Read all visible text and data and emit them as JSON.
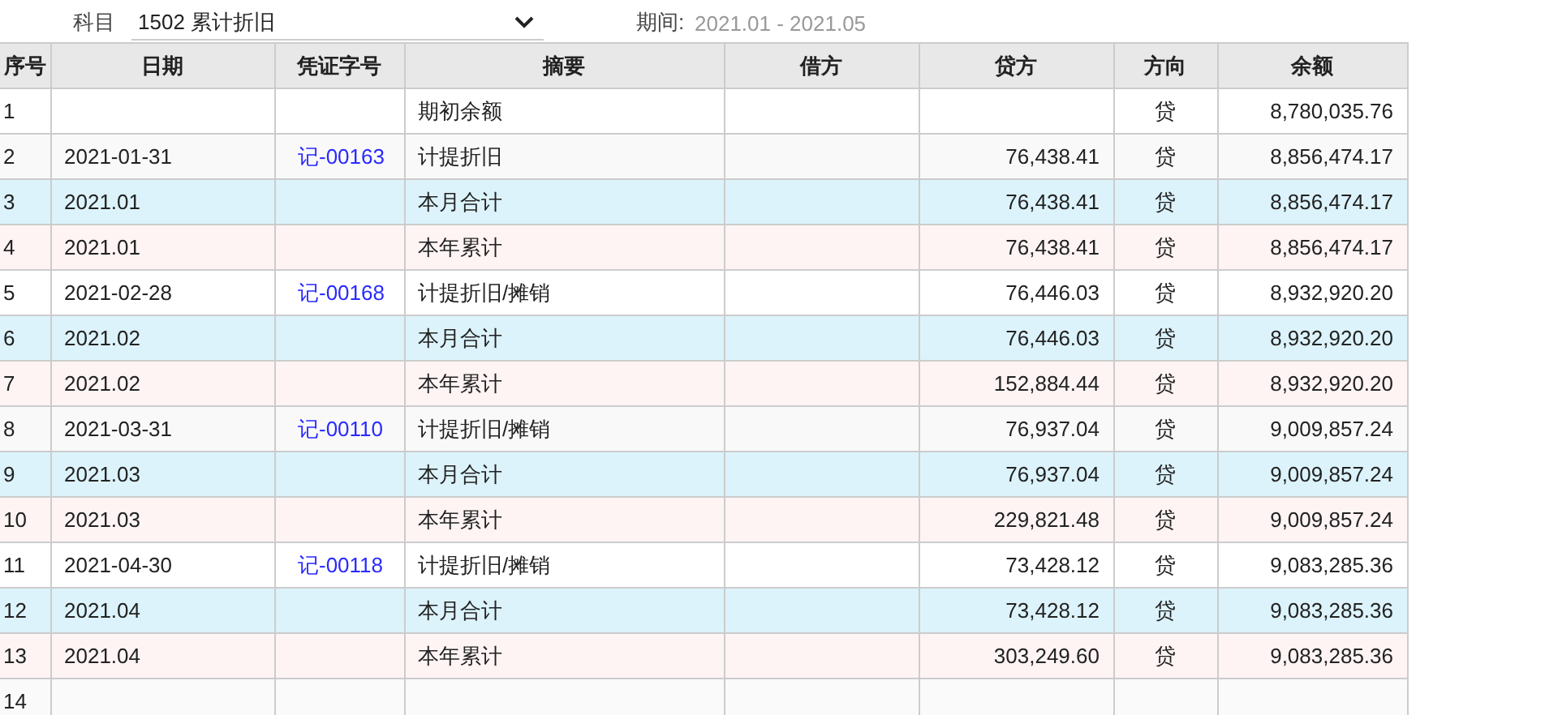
{
  "filters": {
    "subject_label": "科目",
    "subject_value": "1502 累计折旧",
    "period_label": "期间:",
    "period_value": "2021.01 - 2021.05"
  },
  "table": {
    "columns": [
      "序号",
      "日期",
      "凭证字号",
      "摘要",
      "借方",
      "贷方",
      "方向",
      "余额"
    ],
    "rows": [
      {
        "kind": "entry",
        "no": "1",
        "date": "",
        "voucher": "",
        "summary": "期初余额",
        "debit": "",
        "credit": "",
        "direction": "贷",
        "balance": "8,780,035.76"
      },
      {
        "kind": "entry",
        "no": "2",
        "date": "2021-01-31",
        "voucher": "记-00163",
        "summary": "计提折旧",
        "debit": "",
        "credit": "76,438.41",
        "direction": "贷",
        "balance": "8,856,474.17"
      },
      {
        "kind": "month",
        "no": "3",
        "date": "2021.01",
        "voucher": "",
        "summary": "本月合计",
        "debit": "",
        "credit": "76,438.41",
        "direction": "贷",
        "balance": "8,856,474.17"
      },
      {
        "kind": "year",
        "no": "4",
        "date": "2021.01",
        "voucher": "",
        "summary": "本年累计",
        "debit": "",
        "credit": "76,438.41",
        "direction": "贷",
        "balance": "8,856,474.17"
      },
      {
        "kind": "entry",
        "no": "5",
        "date": "2021-02-28",
        "voucher": "记-00168",
        "summary": "计提折旧/摊销",
        "debit": "",
        "credit": "76,446.03",
        "direction": "贷",
        "balance": "8,932,920.20"
      },
      {
        "kind": "month",
        "no": "6",
        "date": "2021.02",
        "voucher": "",
        "summary": "本月合计",
        "debit": "",
        "credit": "76,446.03",
        "direction": "贷",
        "balance": "8,932,920.20"
      },
      {
        "kind": "year",
        "no": "7",
        "date": "2021.02",
        "voucher": "",
        "summary": "本年累计",
        "debit": "",
        "credit": "152,884.44",
        "direction": "贷",
        "balance": "8,932,920.20"
      },
      {
        "kind": "entry",
        "no": "8",
        "date": "2021-03-31",
        "voucher": "记-00110",
        "summary": "计提折旧/摊销",
        "debit": "",
        "credit": "76,937.04",
        "direction": "贷",
        "balance": "9,009,857.24"
      },
      {
        "kind": "month",
        "no": "9",
        "date": "2021.03",
        "voucher": "",
        "summary": "本月合计",
        "debit": "",
        "credit": "76,937.04",
        "direction": "贷",
        "balance": "9,009,857.24"
      },
      {
        "kind": "year",
        "no": "10",
        "date": "2021.03",
        "voucher": "",
        "summary": "本年累计",
        "debit": "",
        "credit": "229,821.48",
        "direction": "贷",
        "balance": "9,009,857.24"
      },
      {
        "kind": "entry",
        "no": "11",
        "date": "2021-04-30",
        "voucher": "记-00118",
        "summary": "计提折旧/摊销",
        "debit": "",
        "credit": "73,428.12",
        "direction": "贷",
        "balance": "9,083,285.36"
      },
      {
        "kind": "month",
        "no": "12",
        "date": "2021.04",
        "voucher": "",
        "summary": "本月合计",
        "debit": "",
        "credit": "73,428.12",
        "direction": "贷",
        "balance": "9,083,285.36"
      },
      {
        "kind": "year",
        "no": "13",
        "date": "2021.04",
        "voucher": "",
        "summary": "本年累计",
        "debit": "",
        "credit": "303,249.60",
        "direction": "贷",
        "balance": "9,083,285.36"
      },
      {
        "kind": "blank",
        "no": "14",
        "date": "",
        "voucher": "",
        "summary": "",
        "debit": "",
        "credit": "",
        "direction": "",
        "balance": ""
      }
    ]
  }
}
